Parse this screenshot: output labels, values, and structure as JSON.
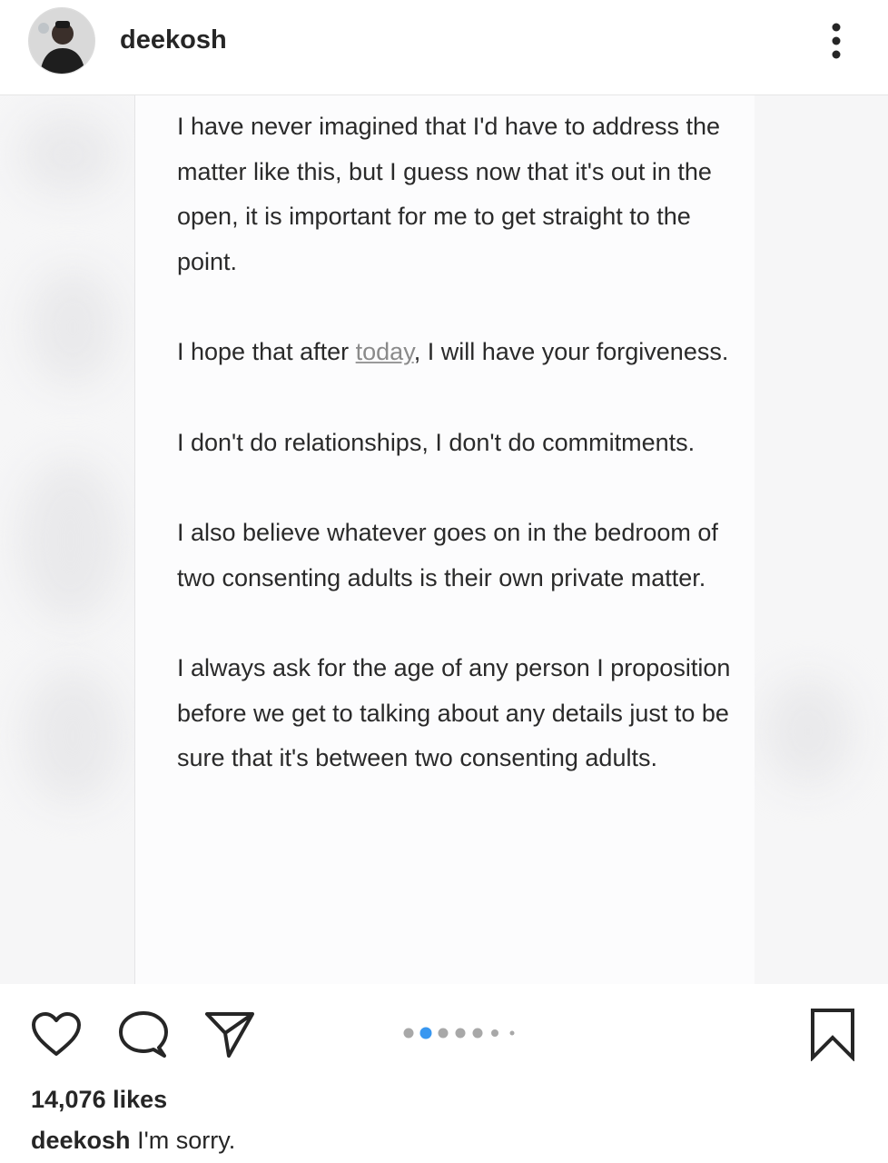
{
  "header": {
    "username": "deekosh",
    "avatar_icon": "user-avatar",
    "more_icon": "more-vertical-icon"
  },
  "post": {
    "paragraphs": [
      {
        "text": "I have never imagined that I'd have to address the matter like this, but I guess now that it's out in the open, it is important for me to get straight to the point."
      },
      {
        "before": "I hope that after ",
        "link": "today",
        "after": ", I will have your forgiveness."
      },
      {
        "text": "I don't do relationships, I don't do commitments."
      },
      {
        "text": "I also believe whatever goes on in the bedroom of two consenting adults is their own private matter."
      },
      {
        "text": "I always ask for the age of any person I proposition before we get to talking about any details just to be sure that it's between two consenting adults."
      }
    ]
  },
  "actions": {
    "like_icon": "heart-icon",
    "comment_icon": "comment-icon",
    "share_icon": "paper-plane-icon",
    "save_icon": "bookmark-icon",
    "carousel": {
      "total": 7,
      "active_index": 1
    },
    "accent_color": "#3897f0"
  },
  "likes": "14,076 likes",
  "caption": {
    "username": "deekosh",
    "text": "I'm sorry."
  }
}
